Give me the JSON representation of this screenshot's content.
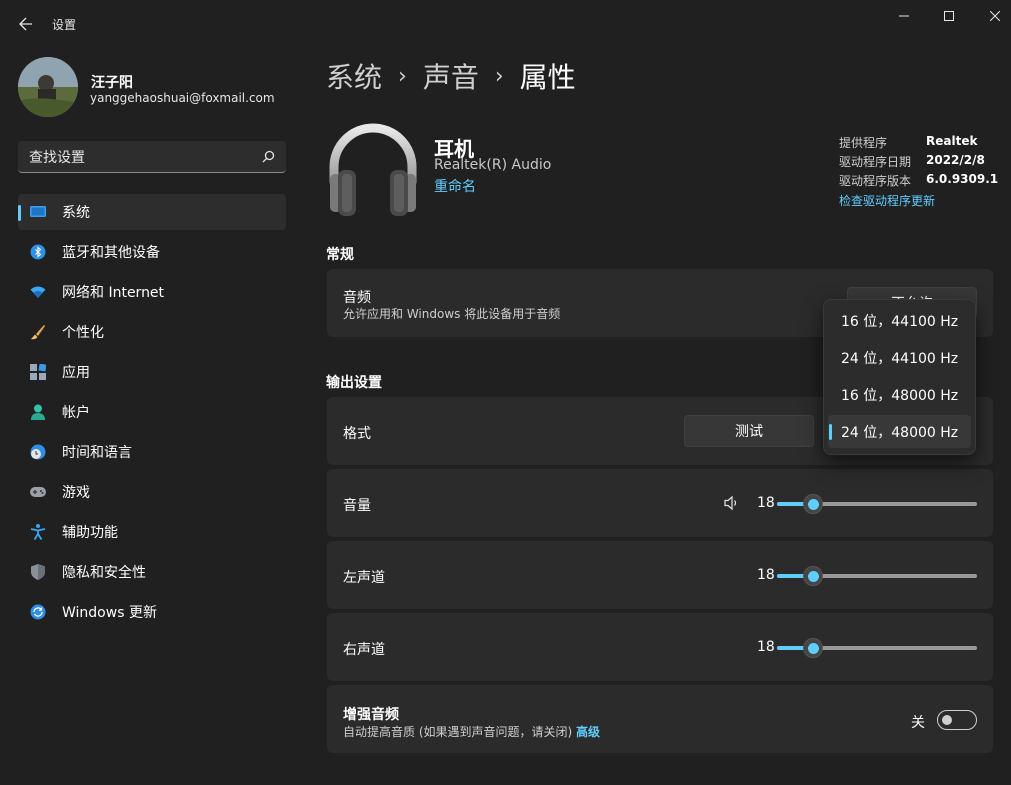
{
  "window": {
    "title": "设置"
  },
  "profile": {
    "name": "汪子阳",
    "email": "yanggehaoshuai@foxmail.com"
  },
  "search": {
    "placeholder": "查找设置"
  },
  "nav": {
    "items": [
      {
        "label": "系统",
        "icon": "monitor-icon",
        "active": true
      },
      {
        "label": "蓝牙和其他设备",
        "icon": "bluetooth-icon"
      },
      {
        "label": "网络和 Internet",
        "icon": "wifi-icon"
      },
      {
        "label": "个性化",
        "icon": "brush-icon"
      },
      {
        "label": "应用",
        "icon": "apps-icon"
      },
      {
        "label": "帐户",
        "icon": "person-icon"
      },
      {
        "label": "时间和语言",
        "icon": "globe-clock-icon"
      },
      {
        "label": "游戏",
        "icon": "gamepad-icon"
      },
      {
        "label": "辅助功能",
        "icon": "accessibility-icon"
      },
      {
        "label": "隐私和安全性",
        "icon": "shield-icon"
      },
      {
        "label": "Windows 更新",
        "icon": "update-icon"
      }
    ]
  },
  "breadcrumb": {
    "items": [
      "系统",
      "声音",
      "属性"
    ]
  },
  "device": {
    "name": "耳机",
    "subtitle": "Realtek(R) Audio",
    "rename": "重命名",
    "props": [
      {
        "key": "提供程序",
        "value": "Realtek"
      },
      {
        "key": "驱动程序日期",
        "value": "2022/2/8"
      },
      {
        "key": "驱动程序版本",
        "value": "6.0.9309.1"
      }
    ],
    "driver_link": "检查驱动程序更新"
  },
  "general": {
    "title": "常规",
    "audio": {
      "title": "音频",
      "desc": "允许应用和 Windows 将此设备用于音频",
      "button": "不允许"
    }
  },
  "output": {
    "title": "输出设置",
    "format": {
      "title": "格式",
      "test_button": "测试"
    },
    "volume": {
      "title": "音量",
      "value": "18"
    },
    "left": {
      "title": "左声道",
      "value": "18"
    },
    "right": {
      "title": "右声道",
      "value": "18"
    },
    "enhance": {
      "title": "增强音频",
      "desc": "自动提高音质 (如果遇到声音问题，请关闭)",
      "link": "高级",
      "state": "关"
    }
  },
  "format_dropdown": {
    "options": [
      "16 位，44100 Hz",
      "24 位，44100 Hz",
      "16 位，48000 Hz",
      "24 位，48000 Hz"
    ],
    "selected_index": 3
  },
  "slider_levels": {
    "volume": 0.18,
    "left": 0.18,
    "right": 0.18
  },
  "colors": {
    "accent": "#60cdff",
    "background": "#202020",
    "card": "#2b2b2b"
  }
}
